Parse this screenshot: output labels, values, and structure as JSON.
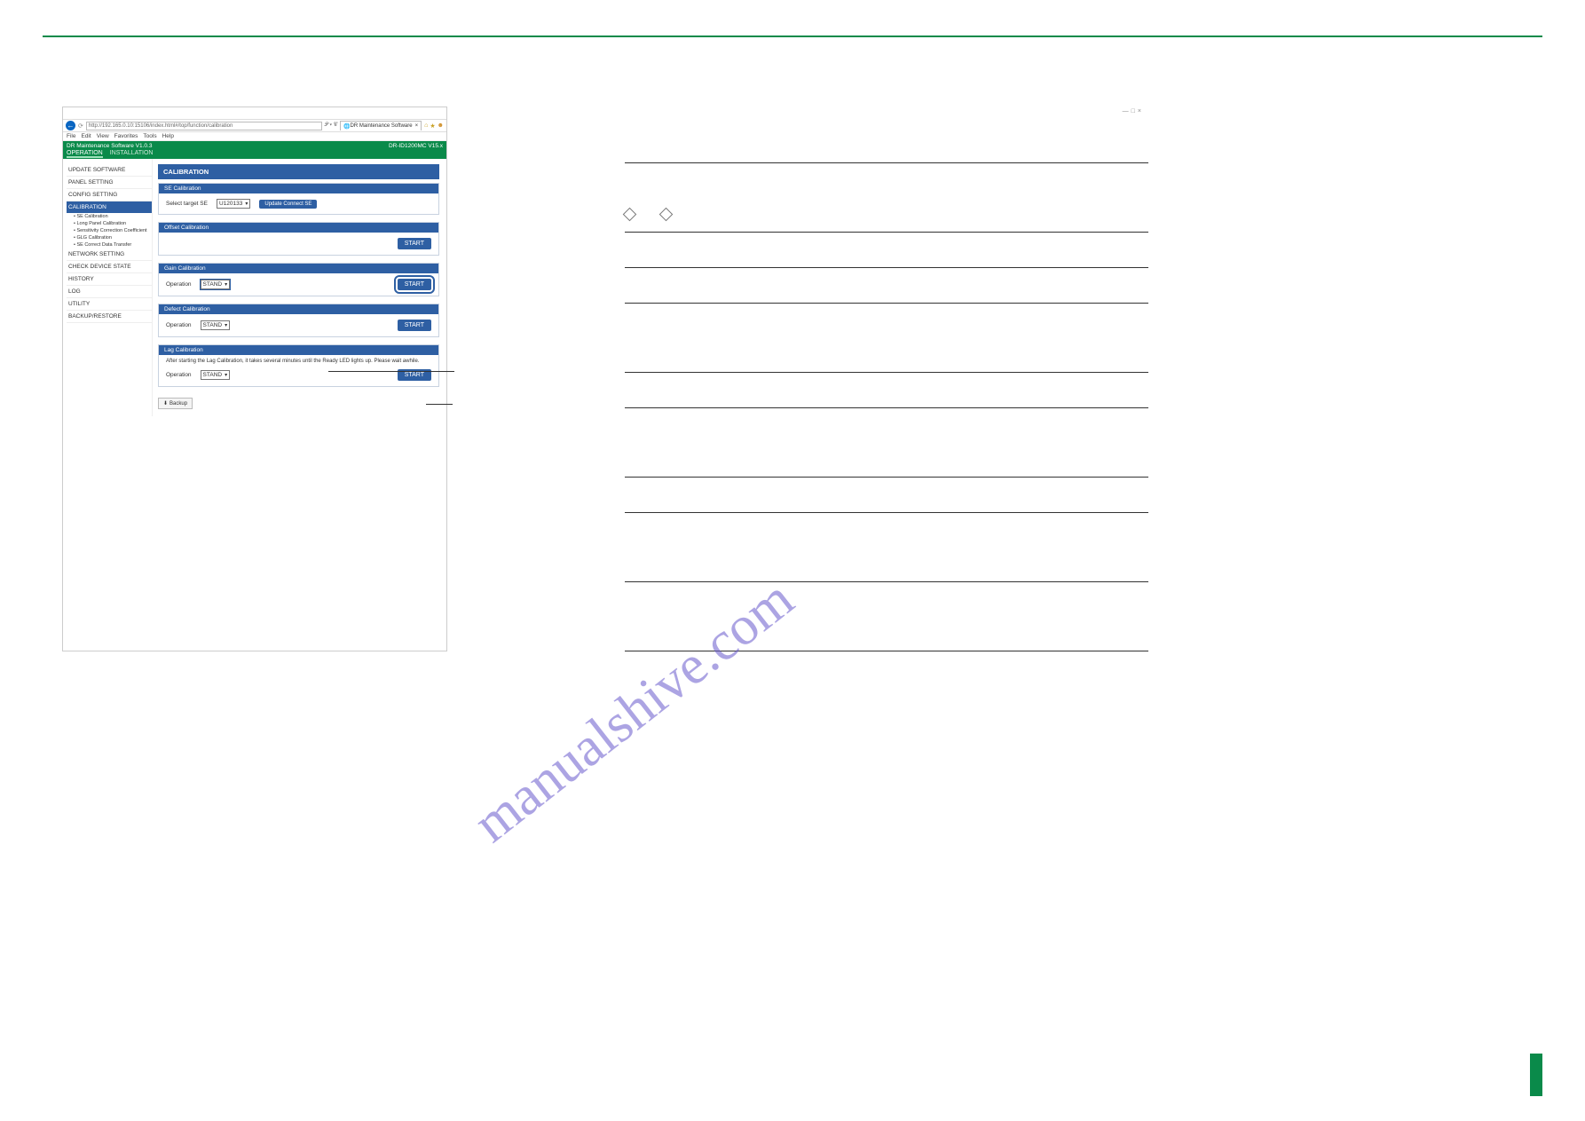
{
  "watermark": "manualshive.com",
  "browser": {
    "url": "http://192.165.0.10:15106/index.html#/top/function/calibration",
    "tab": "DR Maintenance Software",
    "menu": [
      "File",
      "Edit",
      "View",
      "Favorites",
      "Tools",
      "Help"
    ],
    "greenbar_left": "DR Maintenance Software V1.0.3",
    "greenbar_right": "DR-ID1200MC V15.x",
    "win_min": "—",
    "win_max": "□",
    "win_close": "×"
  },
  "tabs": {
    "operation": "OPERATION",
    "installation": "INSTALLATION"
  },
  "side": {
    "items": [
      "UPDATE SOFTWARE",
      "PANEL SETTING",
      "CONFIG SETTING",
      "CALIBRATION",
      "NETWORK SETTING",
      "CHECK DEVICE STATE",
      "HISTORY",
      "LOG",
      "UTILITY",
      "BACKUP/RESTORE"
    ],
    "sub": [
      "SE Calibration",
      "Long Panel Calibration",
      "Sensitivity Correction Coefficient",
      "GLG Calibration",
      "SE Correct Data Transfer"
    ]
  },
  "main": {
    "title": "CALIBRATION",
    "panels": {
      "se": {
        "header": "SE Calibration",
        "label": "Select target SE",
        "value": "U120133",
        "button": "Update Connect SE"
      },
      "offset": {
        "header": "Offset Calibration",
        "start": "START"
      },
      "gain": {
        "header": "Gain Calibration",
        "op_label": "Operation",
        "op_value": "STAND",
        "start": "START"
      },
      "defect": {
        "header": "Defect Calibration",
        "op_label": "Operation",
        "op_value": "STAND",
        "start": "START"
      },
      "lag": {
        "header": "Lag Calibration",
        "note": "After starting the Lag Calibration, it takes several minutes until the Ready LED lights up. Please wait awhile.",
        "op_label": "Operation",
        "op_value": "STAND",
        "start": "START"
      }
    },
    "backup_btn": "Backup"
  }
}
